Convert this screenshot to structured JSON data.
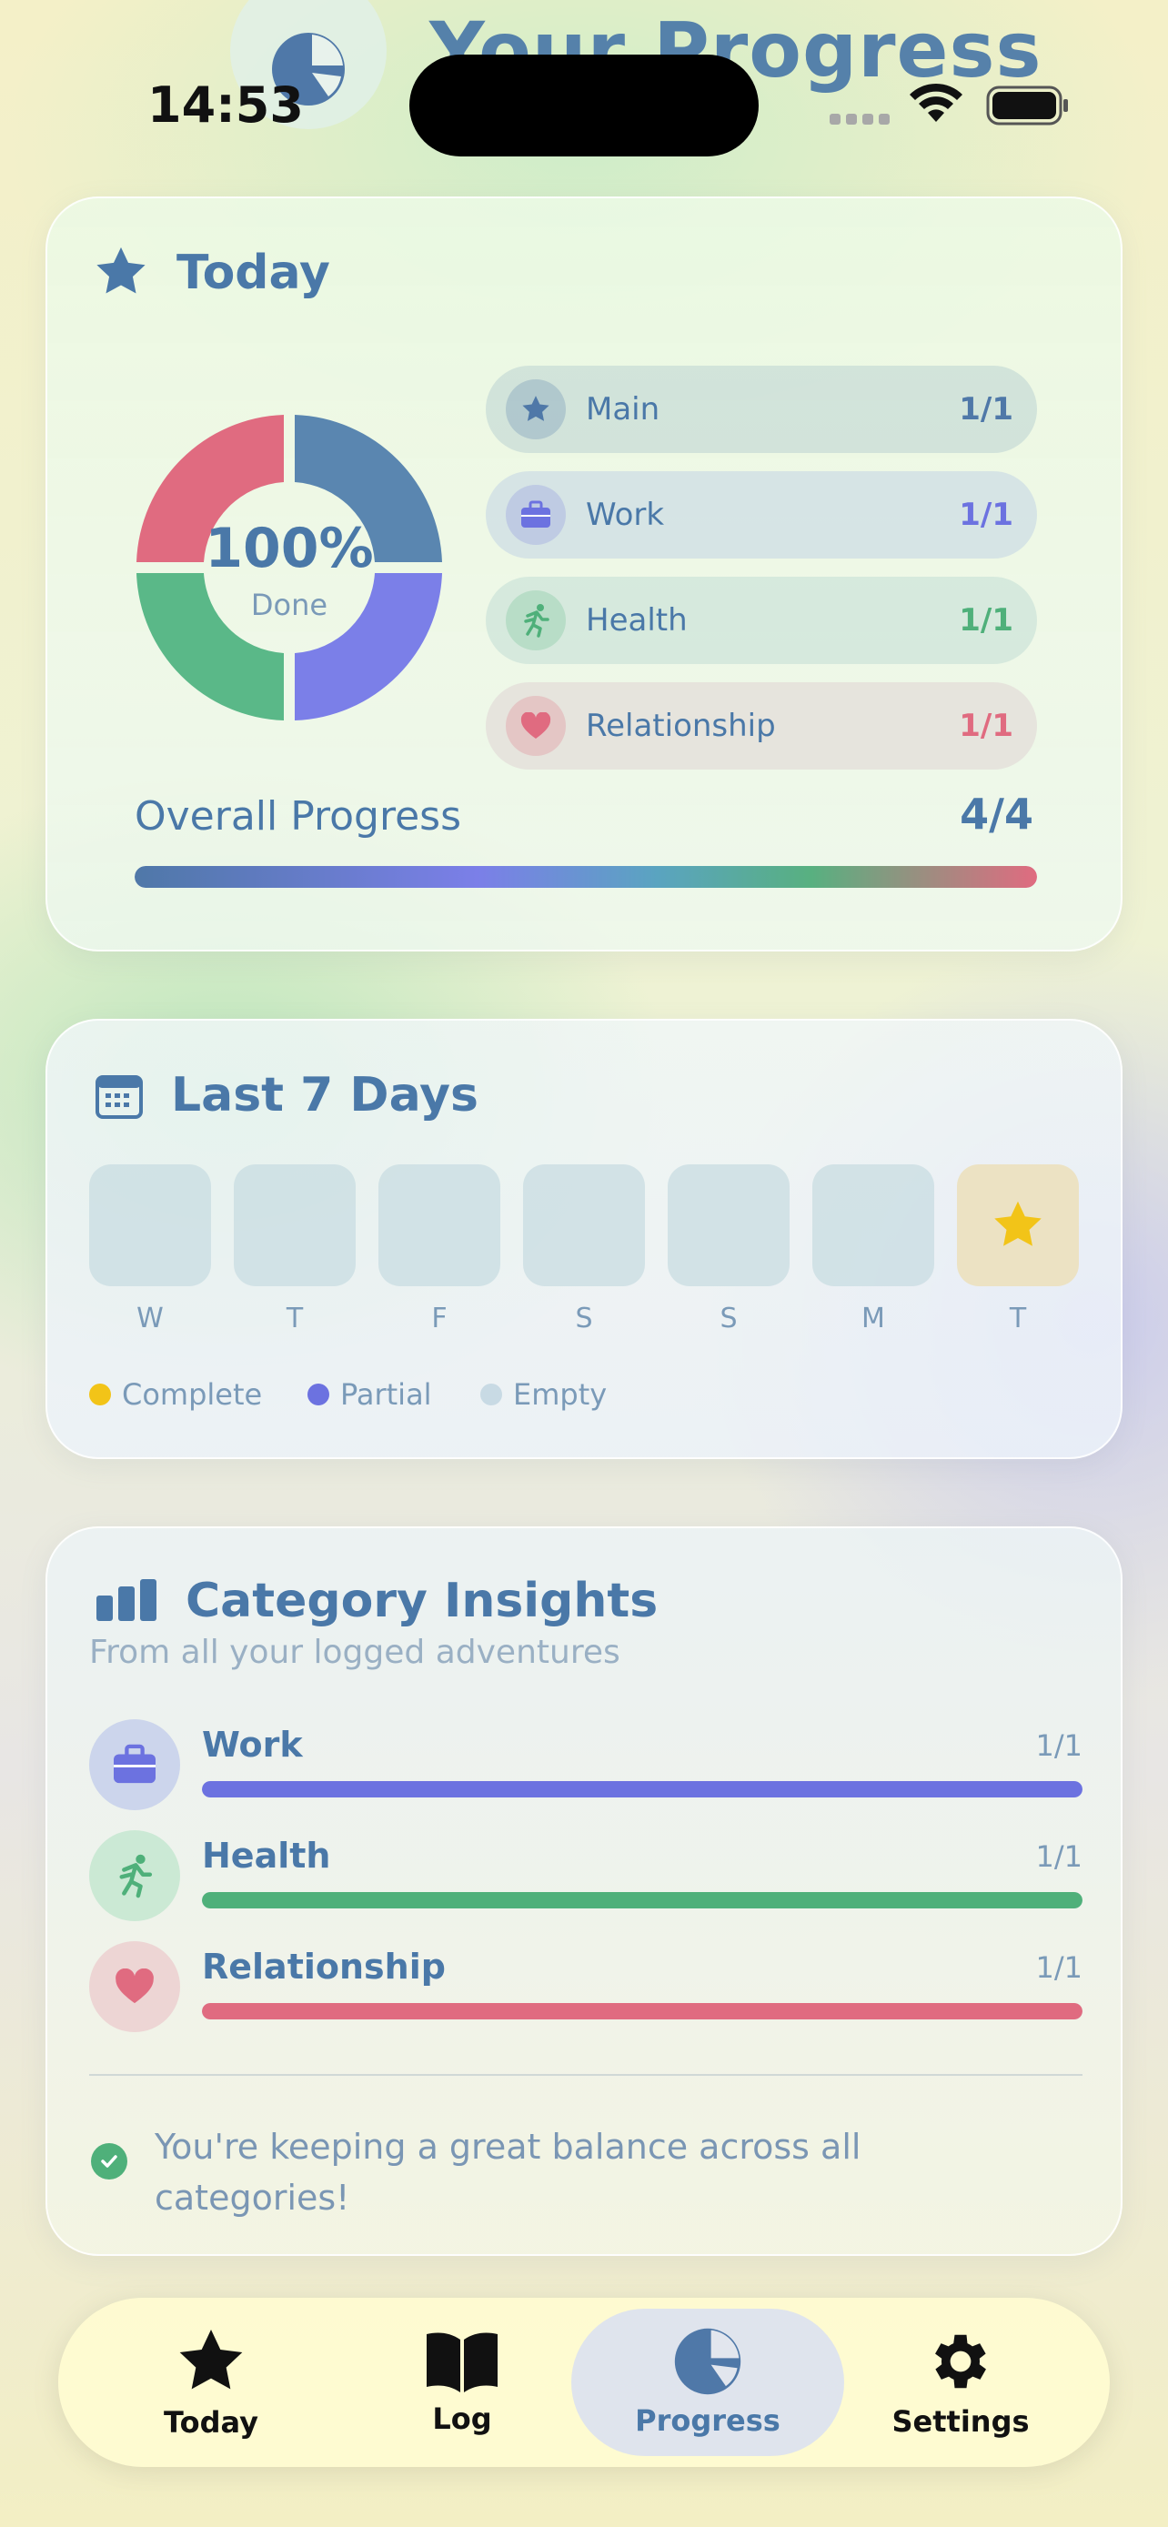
{
  "status_bar": {
    "time": "14:53"
  },
  "header": {
    "title": "Your Progress",
    "badge_icon": "pie-chart-icon"
  },
  "today": {
    "title": "Today",
    "donut": {
      "percent_text": "100%",
      "sub_text": "Done"
    },
    "categories": [
      {
        "label": "Main",
        "count": "1/1",
        "color": "#4f78a8",
        "icon": "star-icon"
      },
      {
        "label": "Work",
        "count": "1/1",
        "color": "#6c72e0",
        "icon": "briefcase-icon"
      },
      {
        "label": "Health",
        "count": "1/1",
        "color": "#4fb07a",
        "icon": "running-icon"
      },
      {
        "label": "Relationship",
        "count": "1/1",
        "color": "#e06b80",
        "icon": "heart-icon"
      }
    ],
    "overall": {
      "label": "Overall Progress",
      "value": "4/4",
      "fraction": 1.0
    }
  },
  "week": {
    "title": "Last 7 Days",
    "days": [
      {
        "label": "W",
        "state": "empty"
      },
      {
        "label": "T",
        "state": "empty"
      },
      {
        "label": "F",
        "state": "empty"
      },
      {
        "label": "S",
        "state": "empty"
      },
      {
        "label": "S",
        "state": "empty"
      },
      {
        "label": "M",
        "state": "empty"
      },
      {
        "label": "T",
        "state": "complete"
      }
    ],
    "legend": [
      {
        "label": "Complete",
        "color": "#f2c418"
      },
      {
        "label": "Partial",
        "color": "#6c72e0"
      },
      {
        "label": "Empty",
        "color": "#c8dae4"
      }
    ]
  },
  "insights": {
    "title": "Category Insights",
    "subtitle": "From all your logged adventures",
    "rows": [
      {
        "name": "Work",
        "count": "1/1",
        "fraction": 1.0,
        "color": "#6c72e0",
        "icon": "briefcase-icon"
      },
      {
        "name": "Health",
        "count": "1/1",
        "fraction": 1.0,
        "color": "#4fb07a",
        "icon": "running-icon"
      },
      {
        "name": "Relationship",
        "count": "1/1",
        "fraction": 1.0,
        "color": "#e06b80",
        "icon": "heart-icon"
      }
    ],
    "message": "You're keeping a great balance across all categories!"
  },
  "tabbar": {
    "tabs": [
      {
        "label": "Today",
        "icon": "star-icon",
        "active": false
      },
      {
        "label": "Log",
        "icon": "book-icon",
        "active": false
      },
      {
        "label": "Progress",
        "icon": "pie-chart-icon",
        "active": true
      },
      {
        "label": "Settings",
        "icon": "gear-icon",
        "active": false
      }
    ]
  }
}
